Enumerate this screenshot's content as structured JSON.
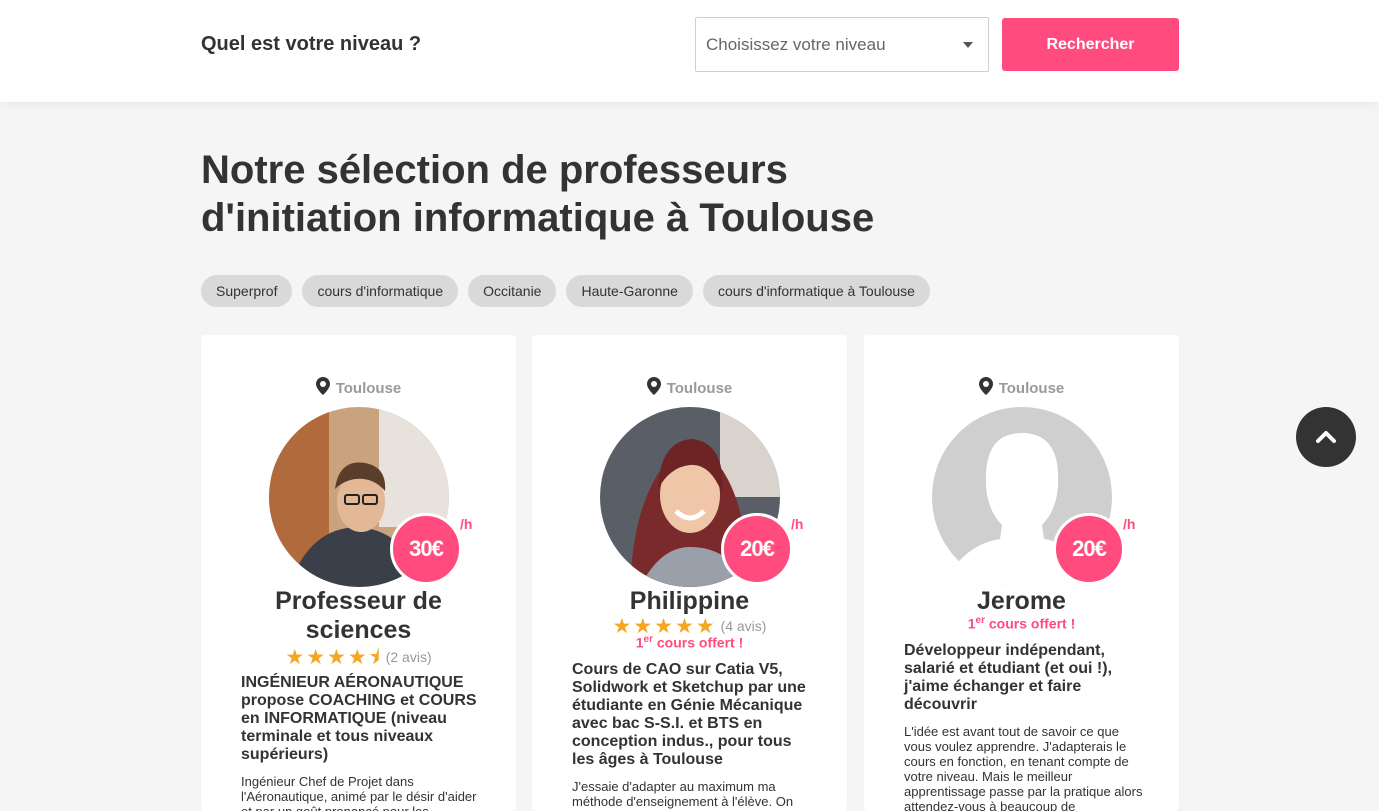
{
  "search": {
    "label": "Quel est votre niveau ?",
    "select_placeholder": "Choisissez votre niveau",
    "button_label": "Rechercher"
  },
  "title": {
    "line1": "Notre sélection de professeurs",
    "line2": "d'initiation informatique à Toulouse"
  },
  "tags": [
    "Superprof",
    "cours d'informatique",
    "Occitanie",
    "Haute-Garonne",
    "cours d'informatique à Toulouse"
  ],
  "cards": [
    {
      "location": "Toulouse",
      "price": "30€",
      "per": "/h",
      "name": "Professeur de sciences",
      "stars": "★★★★⯨",
      "rating": 4.5,
      "reviews": "(2 avis)",
      "headline": "INGÉNIEUR AÉRONAUTIQUE propose COACHING et COURS en INFORMATIQUE (niveau terminale et tous niveaux supérieurs)",
      "description": "Ingénieur Chef de Projet dans l'Aéronautique, animé par le désir d'aider et par un goût prononcé pour les"
    },
    {
      "location": "Toulouse",
      "price": "20€",
      "per": "/h",
      "name": "Philippine",
      "stars": "★★★★★",
      "rating": 5,
      "reviews": "(4 avis)",
      "offer_prefix": "1",
      "offer_sup": "er",
      "offer_text": " cours offert !",
      "headline": "Cours de CAO sur Catia V5, Solidwork et Sketchup par une étudiante en Génie Mécanique avec bac S-S.I. et BTS en conception indus., pour tous les âges à Toulouse",
      "description": "J'essaie d'adapter au maximum ma méthode d'enseignement à l'élève. On"
    },
    {
      "location": "Toulouse",
      "price": "20€",
      "per": "/h",
      "name": "Jerome",
      "offer_prefix": "1",
      "offer_sup": "er",
      "offer_text": " cours offert !",
      "headline": "Développeur indépendant, salarié et étudiant (et oui !), j'aime échanger et faire découvrir",
      "description": "L'idée est avant tout de savoir ce que vous voulez apprendre. J'adapterais le cours en fonction, en tenant compte de votre niveau. Mais le meilleur apprentissage passe par la pratique alors attendez-vous à beaucoup de"
    }
  ],
  "colors": {
    "accent": "#ff4b7d",
    "star": "#f5a623",
    "background": "#f5f5f5"
  },
  "icons": [
    "location-pin-icon",
    "chevron-up-icon",
    "select-caret-icon"
  ]
}
